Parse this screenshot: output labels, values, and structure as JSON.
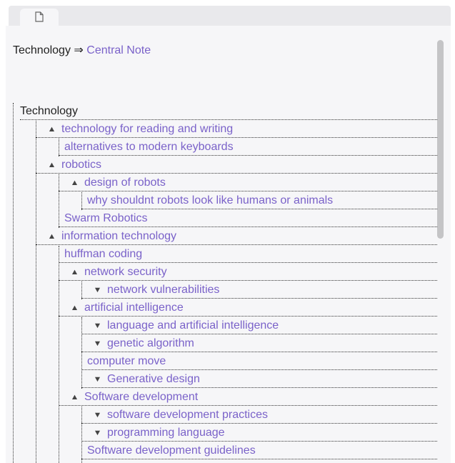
{
  "tab": {
    "icon": "document-icon"
  },
  "breadcrumb": {
    "parent": "Technology",
    "separator": "⇒",
    "current": "Central Note"
  },
  "outline": {
    "root": "Technology",
    "items": [
      {
        "label": "technology for reading and writing",
        "depth": 1,
        "toggle": "expanded"
      },
      {
        "label": "alternatives to modern keyboards",
        "depth": 2,
        "toggle": "none"
      },
      {
        "label": "robotics",
        "depth": 1,
        "toggle": "expanded"
      },
      {
        "label": "design of robots",
        "depth": 2,
        "toggle": "expanded"
      },
      {
        "label": "why shouldnt robots look like humans or animals",
        "depth": 3,
        "toggle": "none"
      },
      {
        "label": "Swarm Robotics",
        "depth": 2,
        "toggle": "none"
      },
      {
        "label": "information technology",
        "depth": 1,
        "toggle": "expanded"
      },
      {
        "label": "huffman coding",
        "depth": 2,
        "toggle": "none"
      },
      {
        "label": "network security",
        "depth": 2,
        "toggle": "expanded"
      },
      {
        "label": "network vulnerabilities",
        "depth": 3,
        "toggle": "collapsed"
      },
      {
        "label": "artificial intelligence",
        "depth": 2,
        "toggle": "expanded"
      },
      {
        "label": "language and artificial intelligence",
        "depth": 3,
        "toggle": "collapsed"
      },
      {
        "label": "genetic algorithm",
        "depth": 3,
        "toggle": "collapsed"
      },
      {
        "label": "computer move",
        "depth": 3,
        "toggle": "none"
      },
      {
        "label": "Generative design",
        "depth": 3,
        "toggle": "collapsed"
      },
      {
        "label": "Software development",
        "depth": 2,
        "toggle": "expanded"
      },
      {
        "label": "software development practices",
        "depth": 3,
        "toggle": "collapsed"
      },
      {
        "label": "programming language",
        "depth": 3,
        "toggle": "collapsed"
      },
      {
        "label": "Software development guidelines",
        "depth": 3,
        "toggle": "none"
      }
    ]
  },
  "colors": {
    "link": "#7a62c9",
    "text": "#222222",
    "panel": "#f6f6f8"
  }
}
